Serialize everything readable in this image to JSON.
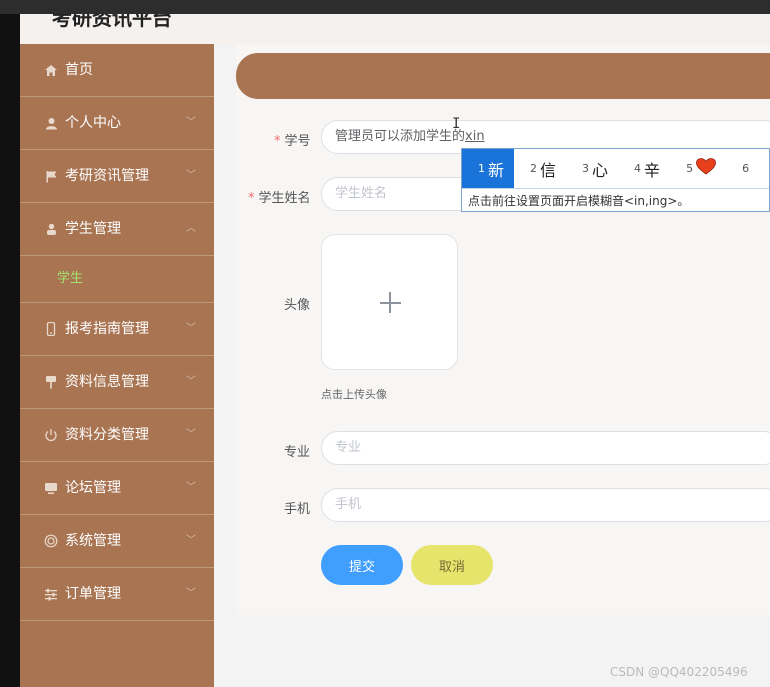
{
  "app": {
    "title": "考研资讯平台"
  },
  "sidebar": {
    "items": [
      {
        "label": "首页",
        "icon": "home-icon",
        "expandable": false
      },
      {
        "label": "个人中心",
        "icon": "user-icon",
        "expandable": true
      },
      {
        "label": "考研资讯管理",
        "icon": "flag-icon",
        "expandable": true
      },
      {
        "label": "学生管理",
        "icon": "person-icon",
        "expandable": true,
        "expanded": true,
        "children": [
          "学生"
        ]
      },
      {
        "label": "报考指南管理",
        "icon": "phone-icon",
        "expandable": true
      },
      {
        "label": "资料信息管理",
        "icon": "pin-icon",
        "expandable": true
      },
      {
        "label": "资料分类管理",
        "icon": "power-icon",
        "expandable": true
      },
      {
        "label": "论坛管理",
        "icon": "monitor-icon",
        "expandable": true
      },
      {
        "label": "系统管理",
        "icon": "target-icon",
        "expandable": true
      },
      {
        "label": "订单管理",
        "icon": "sliders-icon",
        "expandable": true
      }
    ]
  },
  "form": {
    "student_id": {
      "label": "学号",
      "required": true,
      "value_prefix": "管理员可以添加学生的",
      "value_composing": "xin"
    },
    "student_name": {
      "label": "学生姓名",
      "required": true,
      "placeholder": "学生姓名"
    },
    "avatar": {
      "label": "头像",
      "hint": "点击上传头像"
    },
    "major": {
      "label": "专业",
      "placeholder": "专业"
    },
    "phone": {
      "label": "手机",
      "placeholder": "手机"
    },
    "submit_label": "提交",
    "cancel_label": "取消"
  },
  "ime": {
    "candidates": [
      {
        "num": "1",
        "text": "新"
      },
      {
        "num": "2",
        "text": "信"
      },
      {
        "num": "3",
        "text": "心"
      },
      {
        "num": "4",
        "text": "辛"
      },
      {
        "num": "5",
        "text": "❤"
      },
      {
        "num": "6",
        "text": ""
      }
    ],
    "tip": "点击前往设置页面开启模糊音<in,ing>。"
  },
  "watermark": "CSDN @QQ402205496",
  "colors": {
    "sidebar": "#a87452",
    "submit": "#409eff",
    "cancel": "#e6e46a",
    "active_sub": "#a6e36e",
    "required": "#f56c6c"
  }
}
